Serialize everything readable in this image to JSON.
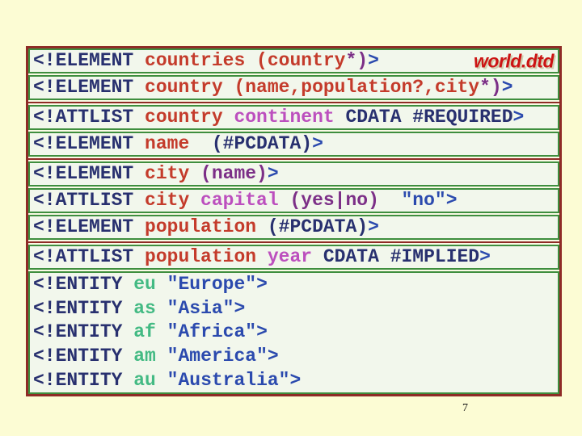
{
  "slide": {
    "page_number": "7",
    "file_label": "world.dtd"
  },
  "colors": {
    "background": "#FCFCD4",
    "box_gap_fill": "#FAFAE6",
    "row_fill": "#F2F7EC",
    "green_border": "#3E8E3E",
    "red_border": "#8F2B26",
    "keyword_navy": "#28306F",
    "element_red": "#C43B2B",
    "attribute_magenta": "#BC4FBE",
    "enum_purple": "#7C2F87",
    "string_blue": "#2B4AAE",
    "entity_green": "#43BA83",
    "label_red": "#CC1414",
    "label_shadow": "#CFCFB0",
    "page_number_color": "#111111"
  },
  "code": {
    "blocks": [
      {
        "type": "line",
        "label": "world.dtd",
        "tokens": [
          [
            "kw",
            "<!ELEMENT "
          ],
          [
            "el",
            "countries (country"
          ],
          [
            "pu",
            "*)"
          ],
          [
            "bl",
            ">"
          ]
        ]
      },
      {
        "type": "line",
        "tokens": [
          [
            "kw",
            "<!ELEMENT "
          ],
          [
            "el",
            "country (name,population?,city"
          ],
          [
            "pu",
            "*)"
          ],
          [
            "bl",
            ">"
          ]
        ]
      },
      {
        "type": "divider"
      },
      {
        "type": "line",
        "tokens": [
          [
            "kw",
            "<!ATTLIST "
          ],
          [
            "el",
            "country "
          ],
          [
            "at",
            "continent "
          ],
          [
            "kw",
            "CDATA #REQUIRED"
          ],
          [
            "bl",
            ">"
          ]
        ]
      },
      {
        "type": "line",
        "tokens": [
          [
            "kw",
            "<!ELEMENT "
          ],
          [
            "el",
            "name "
          ],
          [
            "kw",
            " (#PCDATA)"
          ],
          [
            "bl",
            ">"
          ]
        ]
      },
      {
        "type": "divider"
      },
      {
        "type": "line",
        "tokens": [
          [
            "kw",
            "<!ELEMENT "
          ],
          [
            "el",
            "city "
          ],
          [
            "pu",
            "(name)"
          ],
          [
            "bl",
            ">"
          ]
        ]
      },
      {
        "type": "line",
        "tokens": [
          [
            "kw",
            "<!ATTLIST "
          ],
          [
            "el",
            "city "
          ],
          [
            "at",
            "capital "
          ],
          [
            "pu",
            "(yes|no)"
          ],
          [
            "bl",
            "  \"no\">"
          ]
        ]
      },
      {
        "type": "line",
        "tokens": [
          [
            "kw",
            "<!ELEMENT "
          ],
          [
            "el",
            "population "
          ],
          [
            "kw",
            "(#PCDATA)"
          ],
          [
            "bl",
            ">"
          ]
        ]
      },
      {
        "type": "divider"
      },
      {
        "type": "line",
        "tokens": [
          [
            "kw",
            "<!ATTLIST "
          ],
          [
            "el",
            "population "
          ],
          [
            "at",
            "year "
          ],
          [
            "kw",
            "CDATA #IMPLIED"
          ],
          [
            "bl",
            ">"
          ]
        ]
      },
      {
        "type": "group",
        "lines": [
          [
            [
              "kw",
              "<!ENTITY "
            ],
            [
              "en",
              "eu "
            ],
            [
              "bl",
              "\"Europe\">"
            ]
          ],
          [
            [
              "kw",
              "<!ENTITY "
            ],
            [
              "en",
              "as "
            ],
            [
              "bl",
              "\"Asia\">"
            ]
          ],
          [
            [
              "kw",
              "<!ENTITY "
            ],
            [
              "en",
              "af "
            ],
            [
              "bl",
              "\"Africa\">"
            ]
          ],
          [
            [
              "kw",
              "<!ENTITY "
            ],
            [
              "en",
              "am "
            ],
            [
              "bl",
              "\"America\">"
            ]
          ],
          [
            [
              "kw",
              "<!ENTITY "
            ],
            [
              "en",
              "au "
            ],
            [
              "bl",
              "\"Australia\">"
            ]
          ]
        ]
      }
    ]
  }
}
